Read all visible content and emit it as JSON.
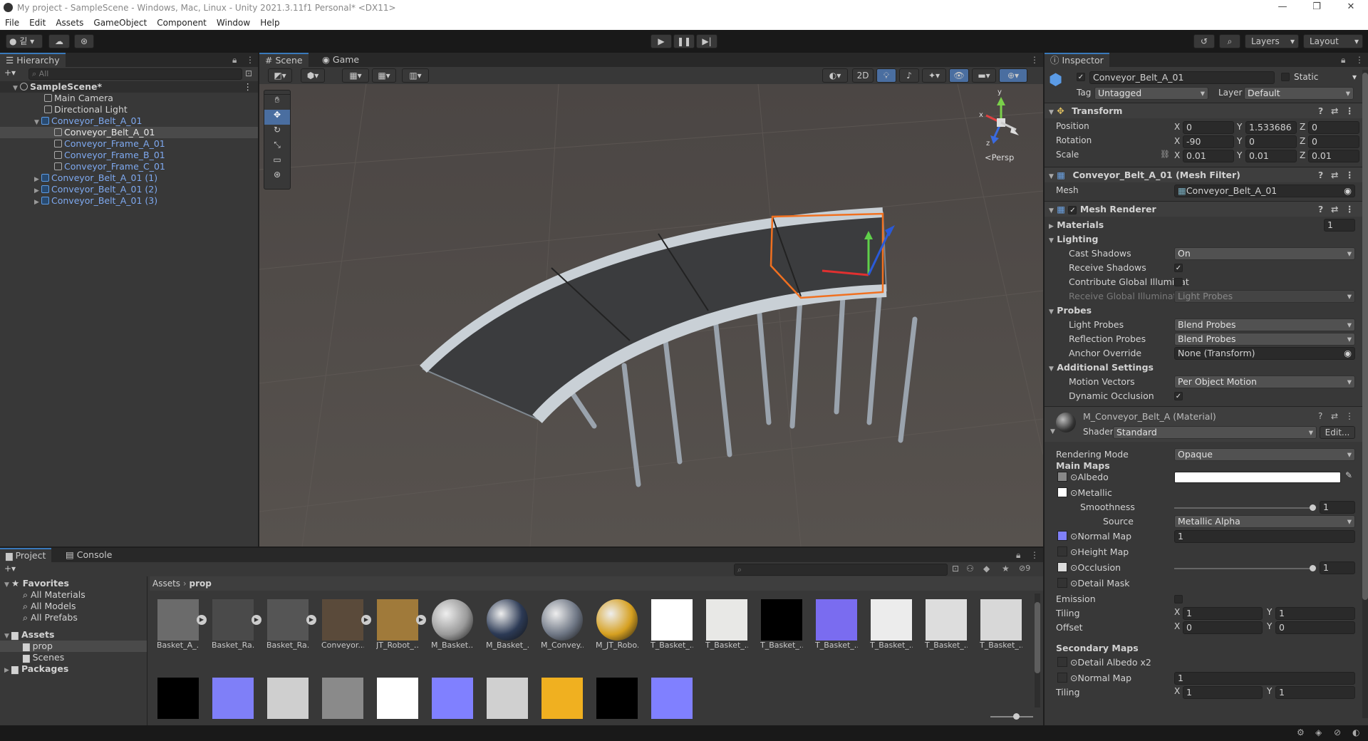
{
  "window": {
    "title": "My project - SampleScene - Windows, Mac, Linux - Unity 2021.3.11f1 Personal* <DX11>"
  },
  "menu": [
    "File",
    "Edit",
    "Assets",
    "GameObject",
    "Component",
    "Window",
    "Help"
  ],
  "toolbar": {
    "account_label": "깉",
    "layers_label": "Layers",
    "layout_label": "Layout"
  },
  "hierarchy": {
    "tab": "Hierarchy",
    "search_placeholder": "All",
    "scene": "SampleScene*",
    "items": [
      {
        "label": "Main Camera"
      },
      {
        "label": "Directional Light"
      },
      {
        "label": "Conveyor_Belt_A_01"
      },
      {
        "label": "Conveyor_Belt_A_01"
      },
      {
        "label": "Conveyor_Frame_A_01"
      },
      {
        "label": "Conveyor_Frame_B_01"
      },
      {
        "label": "Conveyor_Frame_C_01"
      },
      {
        "label": "Conveyor_Belt_A_01 (1)"
      },
      {
        "label": "Conveyor_Belt_A_01 (2)"
      },
      {
        "label": "Conveyor_Belt_A_01 (3)"
      }
    ]
  },
  "scene": {
    "tabs": [
      "Scene",
      "Game"
    ],
    "btn_2d": "2D",
    "gizmo_label": "<Persp",
    "gizmo_axes": {
      "x": "x",
      "y": "y",
      "z": "z"
    }
  },
  "project": {
    "tabs": [
      "Project",
      "Console"
    ],
    "breadcrumb": [
      "Assets",
      "prop"
    ],
    "hidden_count": "9",
    "favorites_label": "Favorites",
    "favorites": [
      "All Materials",
      "All Models",
      "All Prefabs"
    ],
    "assets_label": "Assets",
    "folders": [
      "prop",
      "Scenes"
    ],
    "packages_label": "Packages",
    "assets_row1": [
      {
        "label": "Basket_A_...",
        "kind": "prefab"
      },
      {
        "label": "Basket_Ra...",
        "kind": "prefab"
      },
      {
        "label": "Basket_Ra...",
        "kind": "prefab"
      },
      {
        "label": "Conveyor...",
        "kind": "prefab"
      },
      {
        "label": "JT_Robot_...",
        "kind": "prefab"
      },
      {
        "label": "M_Basket...",
        "kind": "material"
      },
      {
        "label": "M_Basket_...",
        "kind": "material"
      },
      {
        "label": "M_Convey...",
        "kind": "material"
      },
      {
        "label": "M_JT_Robo...",
        "kind": "material"
      },
      {
        "label": "T_Basket_...",
        "kind": "texture"
      },
      {
        "label": "T_Basket_...",
        "kind": "texture"
      },
      {
        "label": "T_Basket_...",
        "kind": "texture"
      },
      {
        "label": "T_Basket_...",
        "kind": "texture"
      },
      {
        "label": "T_Basket_...",
        "kind": "texture"
      },
      {
        "label": "T_Basket_...",
        "kind": "texture"
      },
      {
        "label": "T_Basket_...",
        "kind": "texture"
      }
    ],
    "assets_row2_count_note": "",
    "thumb_colors_row1": [
      "#6b6b6b",
      "#4a4a4a",
      "#555555",
      "#5a4a3a",
      "#a07a3a",
      "#9a9a9a",
      "#2c3a55",
      "#6f7785",
      "#d6a020",
      "#ffffff",
      "#e8e8e6",
      "#000000",
      "#7a6cf0",
      "#ececec",
      "#dddddd",
      "#d8d8d8"
    ],
    "thumb_colors_row2": [
      "#000000",
      "#7f7ff8",
      "#cfcfcf",
      "#8a8a8a",
      "#ffffff",
      "#8080ff",
      "#d0d0d0",
      "#f0b020",
      "#000000",
      "#8080ff"
    ]
  },
  "inspector": {
    "tab": "Inspector",
    "object_name": "Conveyor_Belt_A_01",
    "static_label": "Static",
    "tag_label": "Tag",
    "tag_value": "Untagged",
    "layer_label": "Layer",
    "layer_value": "Default",
    "transform": {
      "title": "Transform",
      "position_label": "Position",
      "rotation_label": "Rotation",
      "scale_label": "Scale",
      "position": {
        "x": "0",
        "y": "1.533686",
        "z": "0"
      },
      "rotation": {
        "x": "-90",
        "y": "0",
        "z": "0"
      },
      "scale": {
        "x": "0.01",
        "y": "0.01",
        "z": "0.01"
      }
    },
    "mesh_filter": {
      "title": "Conveyor_Belt_A_01 (Mesh Filter)",
      "mesh_label": "Mesh",
      "mesh_value": "Conveyor_Belt_A_01"
    },
    "mesh_renderer": {
      "title": "Mesh Renderer",
      "materials_label": "Materials",
      "materials_count": "1",
      "lighting_label": "Lighting",
      "cast_shadows_label": "Cast Shadows",
      "cast_shadows_value": "On",
      "receive_shadows_label": "Receive Shadows",
      "contribute_gi_label": "Contribute Global Illuminat",
      "receive_gi_label": "Receive Global Illuminatior",
      "receive_gi_value": "Light Probes",
      "probes_label": "Probes",
      "light_probes_label": "Light Probes",
      "light_probes_value": "Blend Probes",
      "reflection_probes_label": "Reflection Probes",
      "reflection_probes_value": "Blend Probes",
      "anchor_override_label": "Anchor Override",
      "anchor_override_value": "None (Transform)",
      "additional_label": "Additional Settings",
      "motion_vectors_label": "Motion Vectors",
      "motion_vectors_value": "Per Object Motion",
      "dynamic_occlusion_label": "Dynamic Occlusion"
    },
    "material": {
      "title": "M_Conveyor_Belt_A (Material)",
      "shader_label": "Shader",
      "shader_value": "Standard",
      "edit_label": "Edit...",
      "rendering_mode_label": "Rendering Mode",
      "rendering_mode_value": "Opaque",
      "main_maps_label": "Main Maps",
      "albedo_label": "Albedo",
      "metallic_label": "Metallic",
      "smoothness_label": "Smoothness",
      "smoothness_value": "1",
      "source_label": "Source",
      "source_value": "Metallic Alpha",
      "normal_map_label": "Normal Map",
      "normal_map_value": "1",
      "height_map_label": "Height Map",
      "occlusion_label": "Occlusion",
      "occlusion_value": "1",
      "detail_mask_label": "Detail Mask",
      "emission_label": "Emission",
      "tiling_label": "Tiling",
      "offset_label": "Offset",
      "tiling": {
        "x": "1",
        "y": "1"
      },
      "offset": {
        "x": "0",
        "y": "0"
      },
      "secondary_maps_label": "Secondary Maps",
      "detail_albedo_label": "Detail Albedo x2",
      "normal_map2_label": "Normal Map",
      "normal_map2_value": "1",
      "tiling2": {
        "x": "1",
        "y": "1"
      }
    }
  },
  "colors": {
    "accent": "#3a79bb",
    "selection_outline": "#f07020",
    "prefab_blue": "#7ea9f0"
  }
}
